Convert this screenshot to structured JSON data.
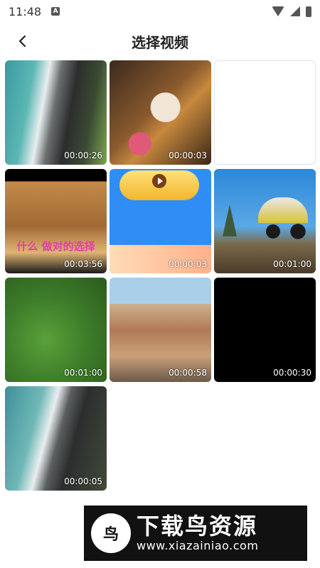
{
  "status_bar": {
    "time": "11:48",
    "notification_icon": "A"
  },
  "header": {
    "back_icon": "chevron-left",
    "title": "选择视频"
  },
  "videos": [
    {
      "duration": "00:00:26"
    },
    {
      "duration": "00:00:03"
    },
    {
      "duration": ""
    },
    {
      "duration": "00:03:56",
      "overlay_text": "什么 做对的选择"
    },
    {
      "duration": "00:00:03"
    },
    {
      "duration": "00:01:00"
    },
    {
      "duration": "00:01:00"
    },
    {
      "duration": "00:00:58"
    },
    {
      "duration": "00:00:30"
    },
    {
      "duration": "00:00:05"
    }
  ],
  "watermark": {
    "name": "下载鸟资源",
    "url": "www.xiazainiao.com"
  }
}
